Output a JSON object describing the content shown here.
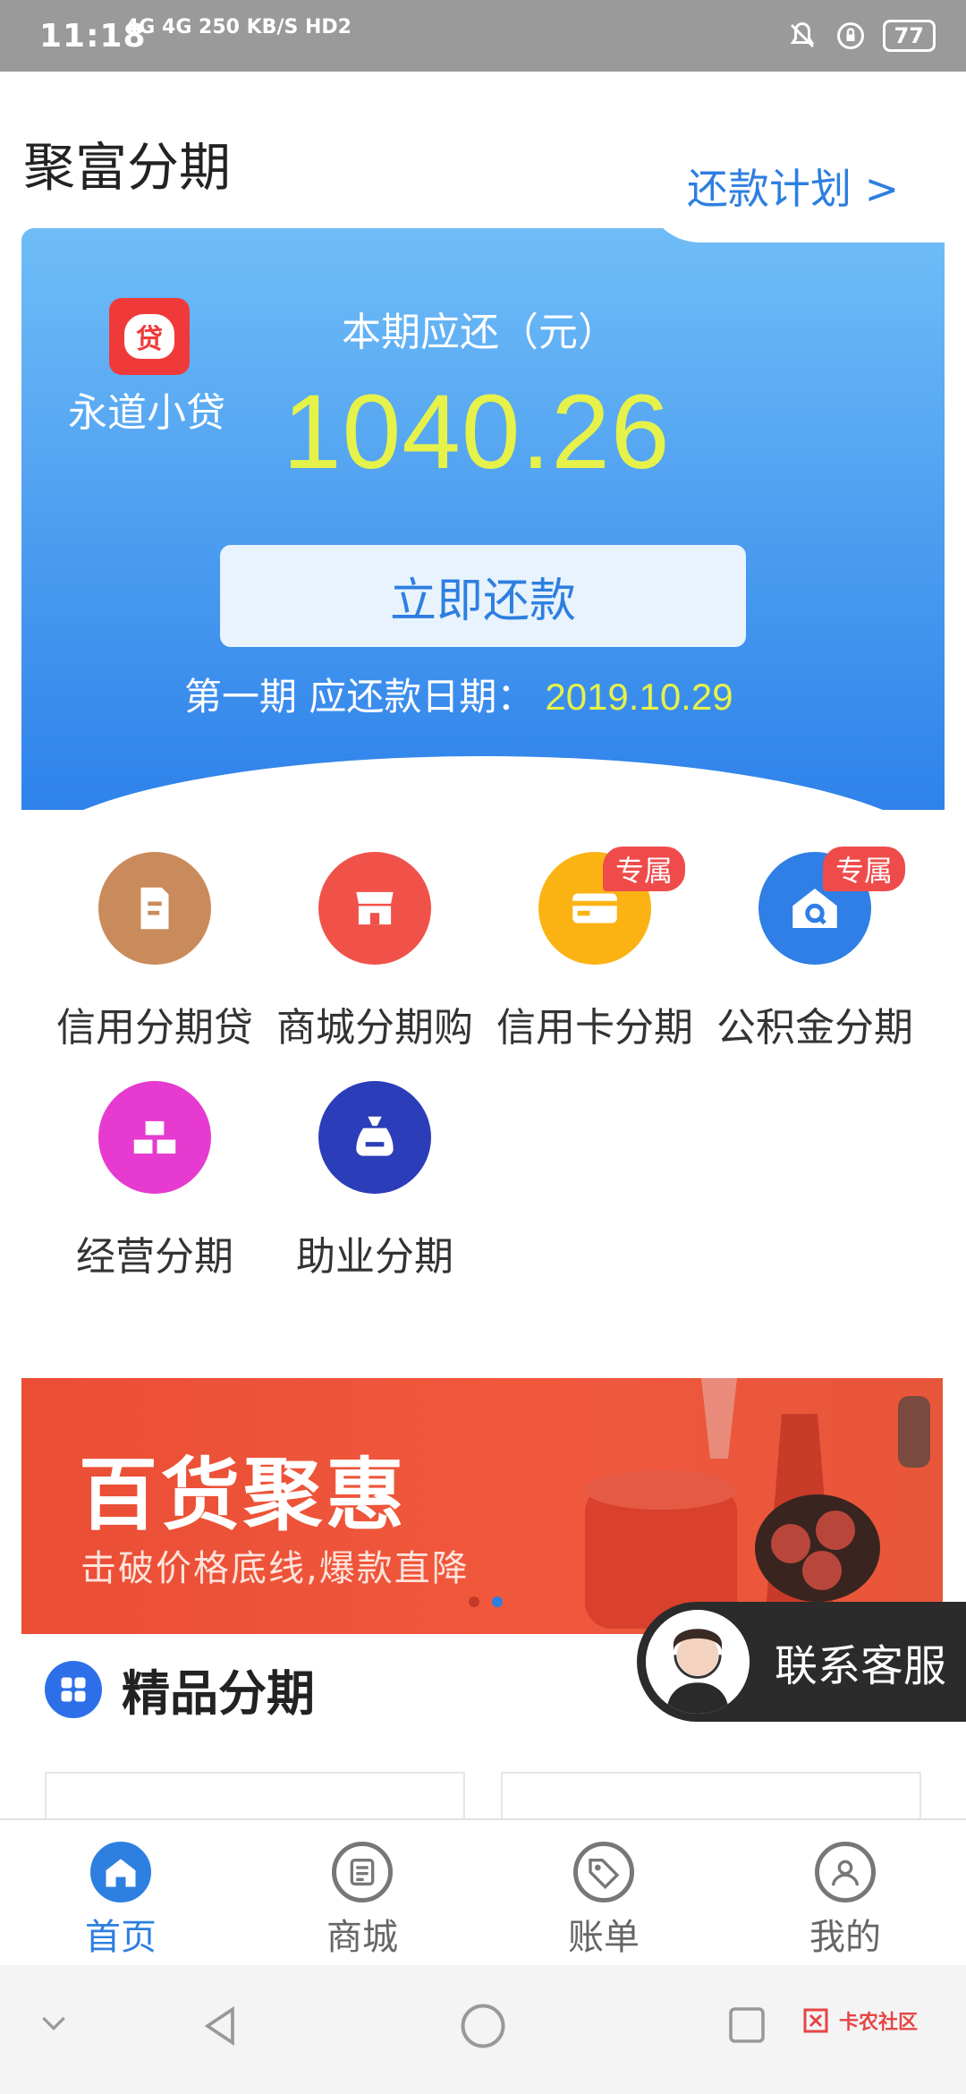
{
  "status_bar": {
    "time": "11:18",
    "network": "4G 4G 250 KB/S HD2",
    "battery": "77"
  },
  "header": {
    "title": "聚富分期"
  },
  "hero": {
    "lender_logo_char": "贷",
    "lender_name": "永道小贷",
    "due_label": "本期应还（元）",
    "due_amount": "1040.26",
    "plan_button": "还款计划 >",
    "repay_button": "立即还款",
    "period_label": "第一期 应还款日期：",
    "due_date": "2019.10.29",
    "colors": {
      "amount": "#e6f24a",
      "accent": "#2d7fe0"
    }
  },
  "services": [
    {
      "label": "信用分期贷",
      "icon": "document-icon",
      "color": "#c98b5b"
    },
    {
      "label": "商城分期购",
      "icon": "shop-icon",
      "color": "#f0524a"
    },
    {
      "label": "信用卡分期",
      "icon": "credit-card-icon",
      "color": "#fbb314",
      "badge": "专属"
    },
    {
      "label": "公积金分期",
      "icon": "house-search-icon",
      "color": "#2f7fe6",
      "badge": "专属"
    },
    {
      "label": "经营分期",
      "icon": "gold-bars-icon",
      "color": "#e63ad0"
    },
    {
      "label": "助业分期",
      "icon": "money-bag-icon",
      "color": "#2b3db8"
    }
  ],
  "banner": {
    "headline": "百货聚惠",
    "subtitle": "击破价格底线,爆款直降",
    "page_count": 2,
    "active_page": 2
  },
  "section": {
    "title": "精品分期"
  },
  "contact": {
    "label": "联系客服"
  },
  "tabbar": [
    {
      "label": "首页",
      "icon": "home-icon",
      "active": true
    },
    {
      "label": "商城",
      "icon": "list-icon",
      "active": false
    },
    {
      "label": "账单",
      "icon": "tag-icon",
      "active": false
    },
    {
      "label": "我的",
      "icon": "user-icon",
      "active": false
    }
  ],
  "watermark": {
    "text": "卡农社区"
  }
}
